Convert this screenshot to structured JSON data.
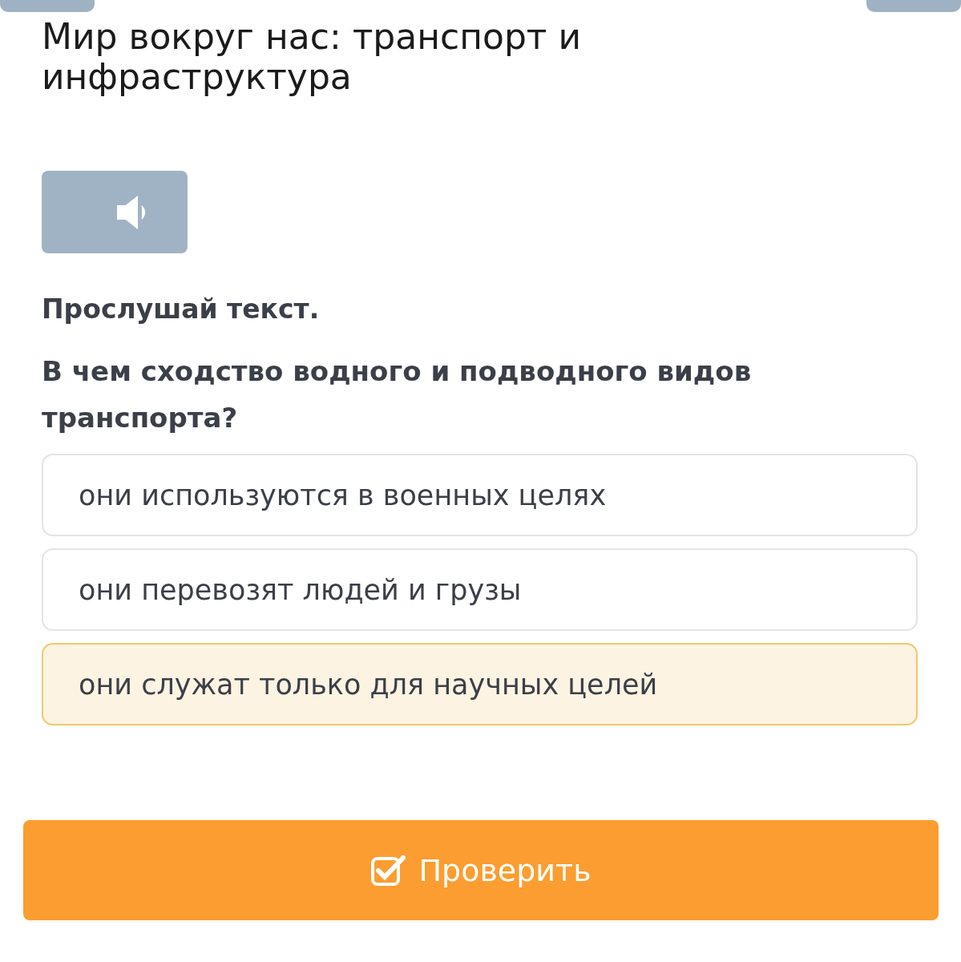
{
  "title": "Мир вокруг нас: транспорт и инфраструктура",
  "instruction": "Прослушай текст.",
  "question": "В чем сходство водного и подводного видов транспорта?",
  "options": [
    {
      "text": "они используются в военных целях",
      "selected": false
    },
    {
      "text": "они перевозят людей и грузы",
      "selected": false
    },
    {
      "text": "они служат только для научных целей",
      "selected": true
    }
  ],
  "check_button": {
    "label": "Проверить"
  }
}
